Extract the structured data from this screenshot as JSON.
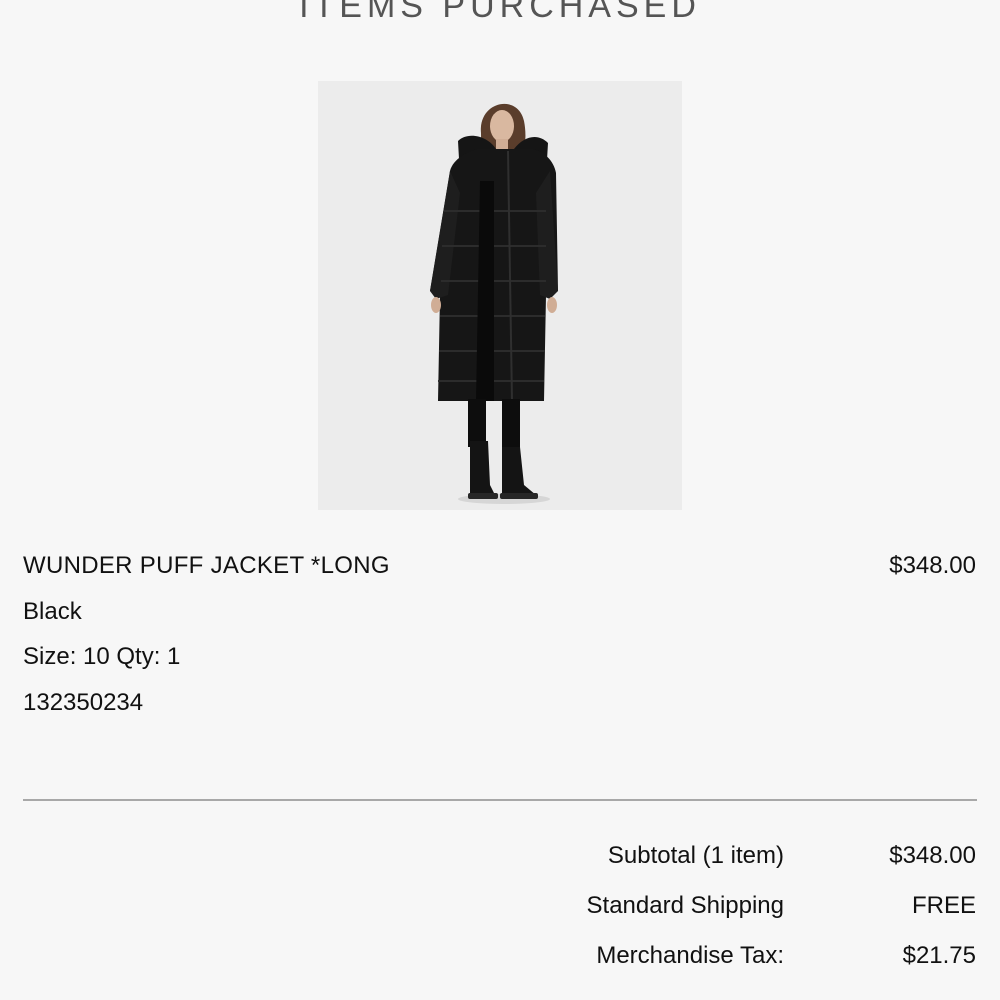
{
  "section_title": "ITEMS PURCHASED",
  "product": {
    "name": "WUNDER PUFF JACKET *LONG",
    "price": "$348.00",
    "color": "Black",
    "size_qty": "Size: 10 Qty: 1",
    "sku": "132350234",
    "image_icon": "product-photo"
  },
  "summary": {
    "subtotal_label": "Subtotal (1 item)",
    "subtotal_value": "$348.00",
    "shipping_label": "Standard Shipping",
    "shipping_value": "FREE",
    "tax_label": "Merchandise Tax:",
    "tax_value": "$21.75"
  }
}
